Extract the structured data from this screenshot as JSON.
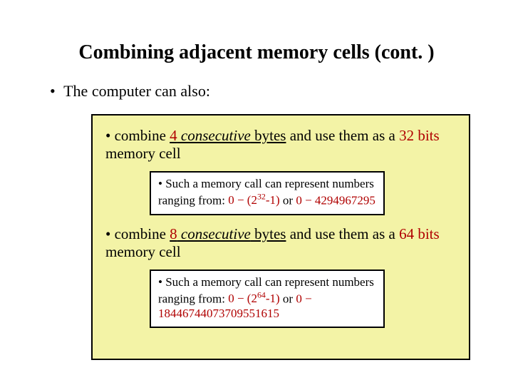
{
  "title": "Combining adjacent memory cells (cont. )",
  "lead_bullet": "•",
  "lead": "The computer can also:",
  "items": [
    {
      "bullet": "•",
      "pre": "combine ",
      "count": "4",
      "consec": " consecutive",
      "bytes": " bytes",
      "mid": " and use them as a ",
      "bits": "32 bits",
      "tail": " memory cell",
      "sub": {
        "bullet": "•",
        "line1": "Such a memory call can represent numbers ranging from: ",
        "range1_a": "0 − (2",
        "range1_exp": "32",
        "range1_b": "-1)",
        "or": " or ",
        "range2": "0 − 4294967295"
      }
    },
    {
      "bullet": "•",
      "pre": "combine ",
      "count": "8",
      "consec": " consecutive",
      "bytes": " bytes",
      "mid": " and use them as a ",
      "bits": "64 bits",
      "tail": " memory cell",
      "sub": {
        "bullet": "•",
        "line1": "Such a memory call can represent numbers ranging from: ",
        "range1_a": "0 − (2",
        "range1_exp": "64",
        "range1_b": "-1)",
        "or": " or ",
        "range2": "0 − 18446744073709551615"
      }
    }
  ]
}
